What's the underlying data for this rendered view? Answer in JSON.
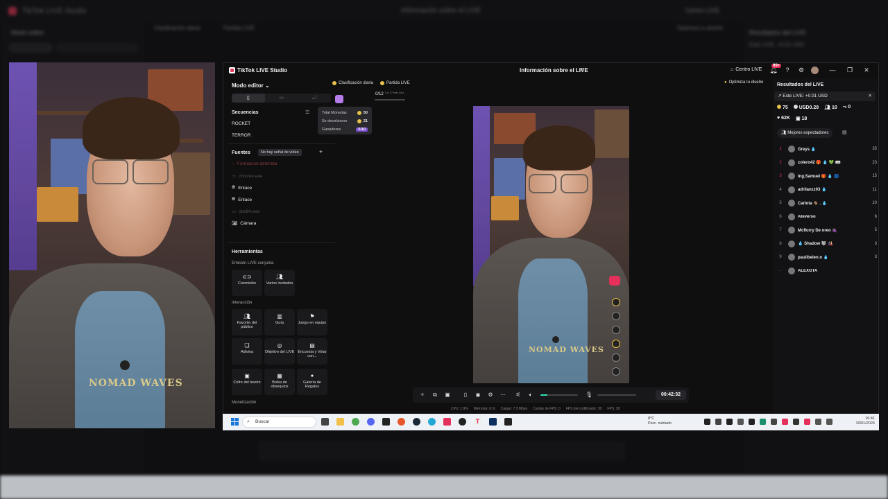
{
  "background": {
    "app_title": "TikTok LIVE Studio",
    "info_title": "Información sobre el LIVE",
    "modo_editor": "Modo editor",
    "centro": "Centro LIVE",
    "resultados": "Resultados del LIVE",
    "este_live": "Este LIVE: +0.01 USD",
    "clasificacion": "Clasificación diaria",
    "partida": "Partida LIVE",
    "optimiza": "Optimiza tu diseño"
  },
  "studio": {
    "app_title": "TikTok LIVE Studio",
    "info_title": "Información sobre el LIVE",
    "centro_live": "Centro LIVE",
    "notif_badge": "99+",
    "modo_editor": "Modo editor",
    "chevron": "⌄",
    "secuencias": {
      "title": "Secuencias",
      "items": [
        "ROCKET",
        "TERROR"
      ]
    },
    "fuentes": {
      "title": "Fuentes",
      "tooltip": "No hay señal de vídeo",
      "items": [
        {
          "label": "Formación detenida",
          "state": "red"
        },
        {
          "label": "chrome.exe",
          "state": "muted"
        },
        {
          "label": "Enlace",
          "state": "normal",
          "icon": "globe-icon"
        },
        {
          "label": "Enlace",
          "state": "normal",
          "icon": "globe-icon"
        },
        {
          "label": "obs64.exe",
          "state": "muted"
        },
        {
          "label": "Cámara",
          "state": "normal",
          "icon": "camera-icon"
        }
      ]
    },
    "herramientas": {
      "title": "Herramientas",
      "emision_title": "Emisión LIVE conjunta",
      "emision": [
        "Coemisión",
        "Varios invitados"
      ],
      "interaccion_title": "Interacción",
      "interaccion": [
        "Favorito del público",
        "Guía",
        "Juego en equipo",
        "Adivina",
        "Objetivo del LIVE",
        "Encuesta y Votar con...",
        "Cofre del tesoro",
        "Bolsa de obsequios",
        "Galería de Regalos"
      ],
      "monetizacion_title": "Monetización"
    },
    "top_chips": {
      "clasificacion": "Clasificación diaria",
      "partida": "Partida LIVE"
    },
    "counter": "0/12",
    "counter_sub": "3 h 17 min 44 s",
    "popover": {
      "rows": [
        {
          "label": "Total Monedas",
          "value": "50"
        },
        {
          "label": "Se devolvieron",
          "value": "21"
        },
        {
          "label": "Ganadores",
          "value": "5/10"
        }
      ]
    },
    "optimiza": "Optimiza tu diseño",
    "timer": "00:42:32",
    "stats": {
      "cpu": "CPU: 1.9%",
      "memoria": "Memoria: 0.%",
      "cargar": "Cargar: 7.3 Mbps",
      "caidas": "Caídas de FPS: 0",
      "fps_cod": "FPS del codificador: 30",
      "fps": "FPS: 30"
    },
    "volume_level": 0.18,
    "results": {
      "title": "Resultados del LIVE",
      "este_live": "Este LIVE: +0.01 USD",
      "close": "✕",
      "stats_row1": [
        "75",
        "USD0.28",
        "10",
        "0"
      ],
      "stats_row2": [
        "62K",
        "18"
      ],
      "mejores": "Mejores espectadores",
      "viewers": [
        {
          "rank": "1",
          "name": "Greys 💧",
          "count": "35",
          "rank_color": "#e5305b"
        },
        {
          "rank": "2",
          "name": "colero42 🎁 💧 💚 🎟",
          "count": "23",
          "rank_color": "#e5305b"
        },
        {
          "rank": "3",
          "name": "Ing.Samuel 🎁 💧 🌀",
          "count": "15",
          "rank_color": "#e5305b"
        },
        {
          "rank": "4",
          "name": "adrilanzz03 💧",
          "count": "11",
          "rank_color": "#999999"
        },
        {
          "rank": "5",
          "name": "Carlota 🐐 . 💧",
          "count": "10",
          "rank_color": "#999999"
        },
        {
          "rank": "6",
          "name": "Ateverso",
          "count": "6",
          "rank_color": "#999999"
        },
        {
          "rank": "7",
          "name": "Mcflurry De oreo 🍇",
          "count": "5",
          "rank_color": "#999999"
        },
        {
          "rank": "8",
          "name": "💧 Shadow 🐺 🎎",
          "count": "3",
          "rank_color": "#999999"
        },
        {
          "rank": "9",
          "name": "paulibelen.n 💧",
          "count": "3",
          "rank_color": "#999999"
        },
        {
          "rank": "-",
          "name": "ALEXGTA",
          "count": "",
          "rank_color": "#999999"
        }
      ]
    }
  },
  "webcam": {
    "shirt_text": "NOMAD WAVES"
  },
  "preview": {
    "shirt_text": "NOMAD WAVES"
  },
  "taskbar": {
    "search_placeholder": "Buscar",
    "weather_temp": "8°C",
    "weather_desc": "Parc. nublado",
    "time": "16:41",
    "date": "10/01/2026"
  }
}
